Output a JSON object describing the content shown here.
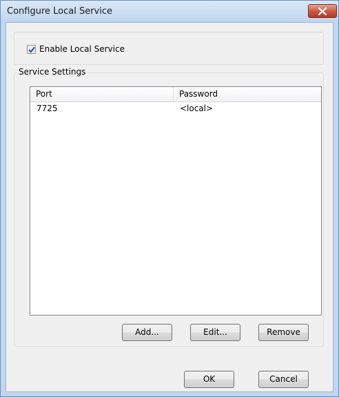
{
  "window": {
    "title": "Configure Local Service"
  },
  "enable_checkbox": {
    "label": "Enable Local Service",
    "checked": true
  },
  "service_settings": {
    "group_label": "Service Settings",
    "columns": [
      "Port",
      "Password"
    ],
    "rows": [
      {
        "port": "7725",
        "password": "<local>"
      }
    ]
  },
  "actions": {
    "add_label": "Add...",
    "edit_label": "Edit...",
    "remove_label": "Remove"
  },
  "dialog_buttons": {
    "ok_label": "OK",
    "cancel_label": "Cancel"
  }
}
